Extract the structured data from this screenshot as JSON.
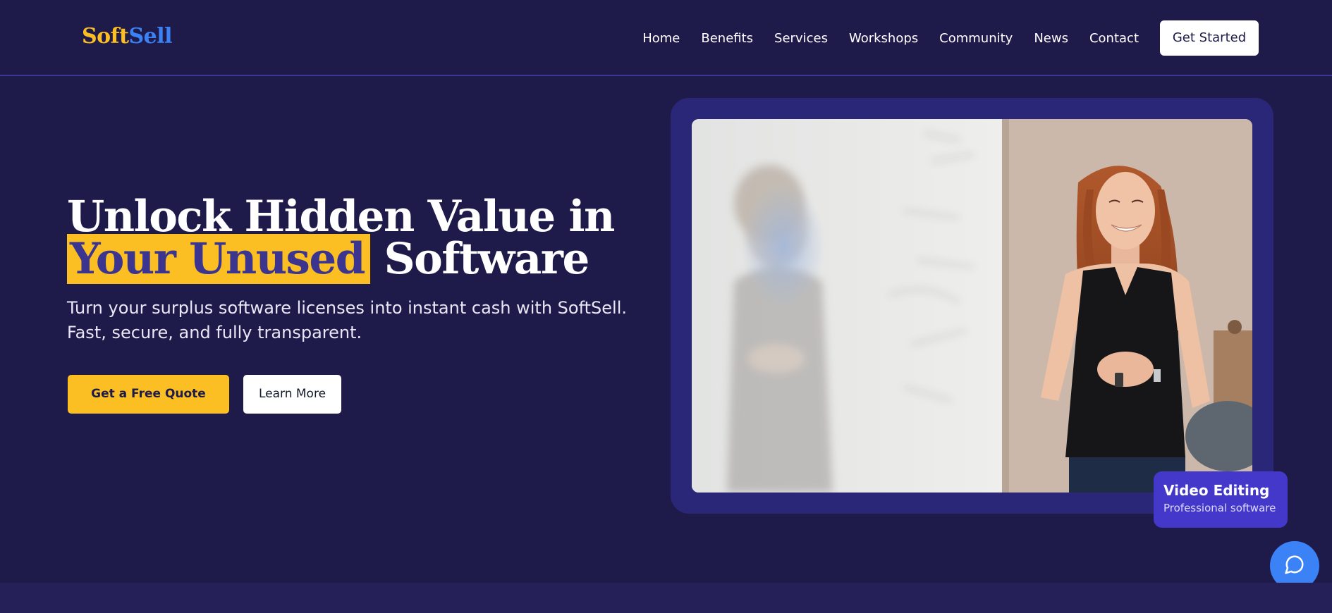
{
  "brand": {
    "part1": "Soft",
    "part2": "Sell",
    "colors": {
      "soft": "#fbbf24",
      "sell": "#3b82f6"
    }
  },
  "nav": {
    "items": [
      "Home",
      "Benefits",
      "Services",
      "Workshops",
      "Community",
      "News",
      "Contact"
    ],
    "cta": "Get Started"
  },
  "hero": {
    "title_line1": "Unlock Hidden Value in",
    "title_highlight": "Your Unused",
    "title_line2_rest": "Software",
    "subtitle": "Turn your surplus software licenses into instant cash with SoftSell. Fast, secure, and fully transparent.",
    "primary_cta": "Get a Free Quote",
    "secondary_cta": "Learn More"
  },
  "image_badge": {
    "title": "Video Editing",
    "subtitle": "Professional software"
  },
  "icons": {
    "chat": "chat-bubble-icon"
  },
  "colors": {
    "background": "#1e1b4b",
    "accent_yellow": "#fbbf24",
    "accent_blue": "#3b82f6",
    "frame": "#2b2778",
    "badge": "#4338ca"
  }
}
